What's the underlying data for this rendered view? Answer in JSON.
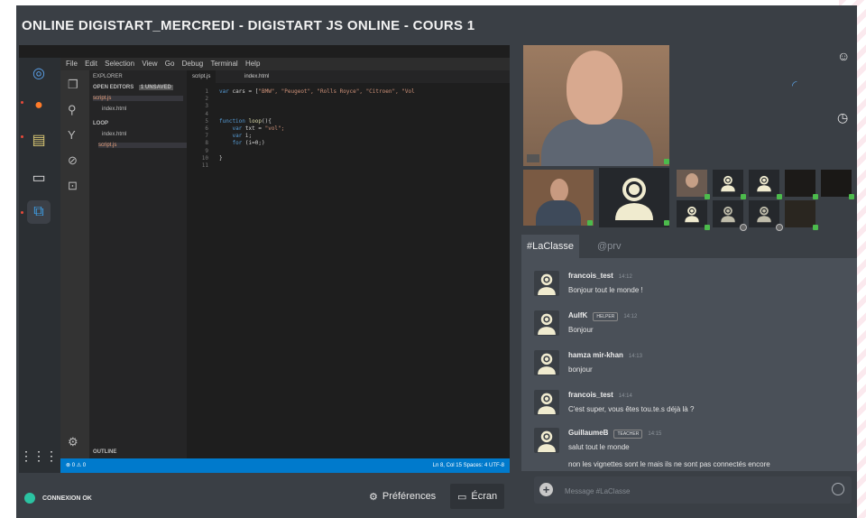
{
  "title": "ONLINE DIGISTART_MERCREDI - DIGISTART JS ONLINE - COURS 1",
  "screen_share": {
    "menu": [
      "File",
      "Edit",
      "Selection",
      "View",
      "Go",
      "Debug",
      "Terminal",
      "Help"
    ],
    "explorer": {
      "header": "EXPLORER",
      "open_editors": "OPEN EDITORS",
      "unsaved": "1 UNSAVED",
      "open_files": [
        "script.js",
        "index.html"
      ],
      "folder": "LOOP",
      "folder_files": [
        "index.html",
        "script.js"
      ],
      "outline": "OUTLINE"
    },
    "tabs": [
      "script.js",
      "index.html"
    ],
    "line_numbers": [
      "1",
      "2",
      "3",
      "4",
      "5",
      "6",
      "7",
      "8",
      "9",
      "10",
      "11"
    ],
    "code": {
      "l1_kw": "var",
      "l1_rest": " cars = [",
      "l1_str": "\"BMW\", \"Peugeot\", \"Rolls Royce\", \"Citroen\", \"Vol",
      "l5_kw": "function",
      "l5_fn": " loop",
      "l5_rest": "(){",
      "l6_kw": "var",
      "l6_rest": " txt = ",
      "l6_str": "\"vol\";",
      "l7_kw": "var",
      "l7_rest": " i;",
      "l8_kw": "for",
      "l8_rest": " (i=0;)",
      "l10": "}"
    },
    "status_left": "⊗ 0 ⚠ 0",
    "status_right": "Ln 8, Col 15   Spaces: 4   UTF-8"
  },
  "bottom": {
    "connection": "CONNEXION OK",
    "preferences": "Préférences",
    "screen": "Écran"
  },
  "chat": {
    "tabs": [
      "#LaClasse",
      "@prv"
    ],
    "messages": [
      {
        "name": "francois_test",
        "time": "14:12",
        "badge": "",
        "text": "Bonjour tout le monde !"
      },
      {
        "name": "AulfK",
        "time": "14:12",
        "badge": "HELPER",
        "text": "Bonjour"
      },
      {
        "name": "hamza mir-khan",
        "time": "14:13",
        "badge": "",
        "text": "bonjour"
      },
      {
        "name": "francois_test",
        "time": "14:14",
        "badge": "",
        "text": "C'est super, vous êtes tou.te.s déjà là ?"
      },
      {
        "name": "GuillaumeB",
        "time": "14:15",
        "badge": "TEACHER",
        "text": "salut tout le monde",
        "text2": "non les vignettes sont le mais ils ne sont pas connectés encore"
      }
    ],
    "placeholder": "Message #LaClasse"
  },
  "colors": {
    "app_bg": "#3a3f45",
    "chat_bg": "#4a5058",
    "connected": "#2bc3a2",
    "online": "#4cbb4c",
    "vscode_status": "#007acc"
  }
}
